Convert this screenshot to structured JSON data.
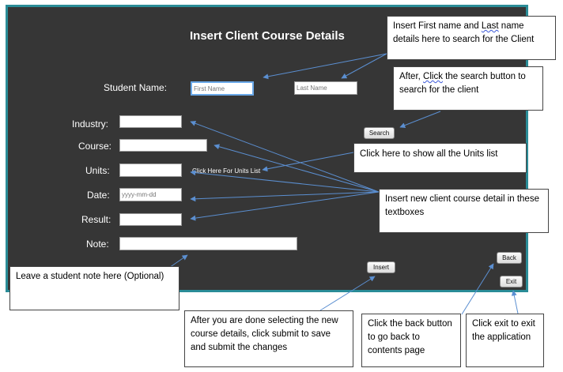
{
  "form": {
    "title": "Insert Client Course Details",
    "student_name_label": "Student Name:",
    "first_name_placeholder": "First Name",
    "last_name_placeholder": "Last Name",
    "search_label": "Search",
    "industry_label": "Industry:",
    "course_label": "Course:",
    "units_label": "Units:",
    "units_link": "Click Here For Units List",
    "date_label": "Date:",
    "date_placeholder": "yyyy-mm-dd",
    "result_label": "Result:",
    "note_label": "Note:",
    "insert_label": "Insert",
    "back_label": "Back",
    "exit_label": "Exit"
  },
  "annotations": {
    "name_note": {
      "line1_a": "Insert First name and ",
      "line1_b": "Last",
      "line1_c": " name",
      "line2": "details here to search for the Client"
    },
    "search_note": {
      "line1_a": "After, ",
      "line1_b": "Click",
      "line1_c": " the search button to",
      "line2": "search for the client"
    },
    "units_note": "Click here to show all the Units list",
    "textbox_note": "Insert new client course detail in these textboxes",
    "student_note": "Leave a student note here (Optional)",
    "insert_note": "After you are done selecting the new course details, click submit to save and submit the changes",
    "back_note": "Click the back button to go back to contents page",
    "exit_note": "Click exit to exit the application"
  },
  "colors": {
    "panel_bg": "#363636",
    "panel_border": "#2a8c97",
    "arrow": "#5b8fd1"
  }
}
